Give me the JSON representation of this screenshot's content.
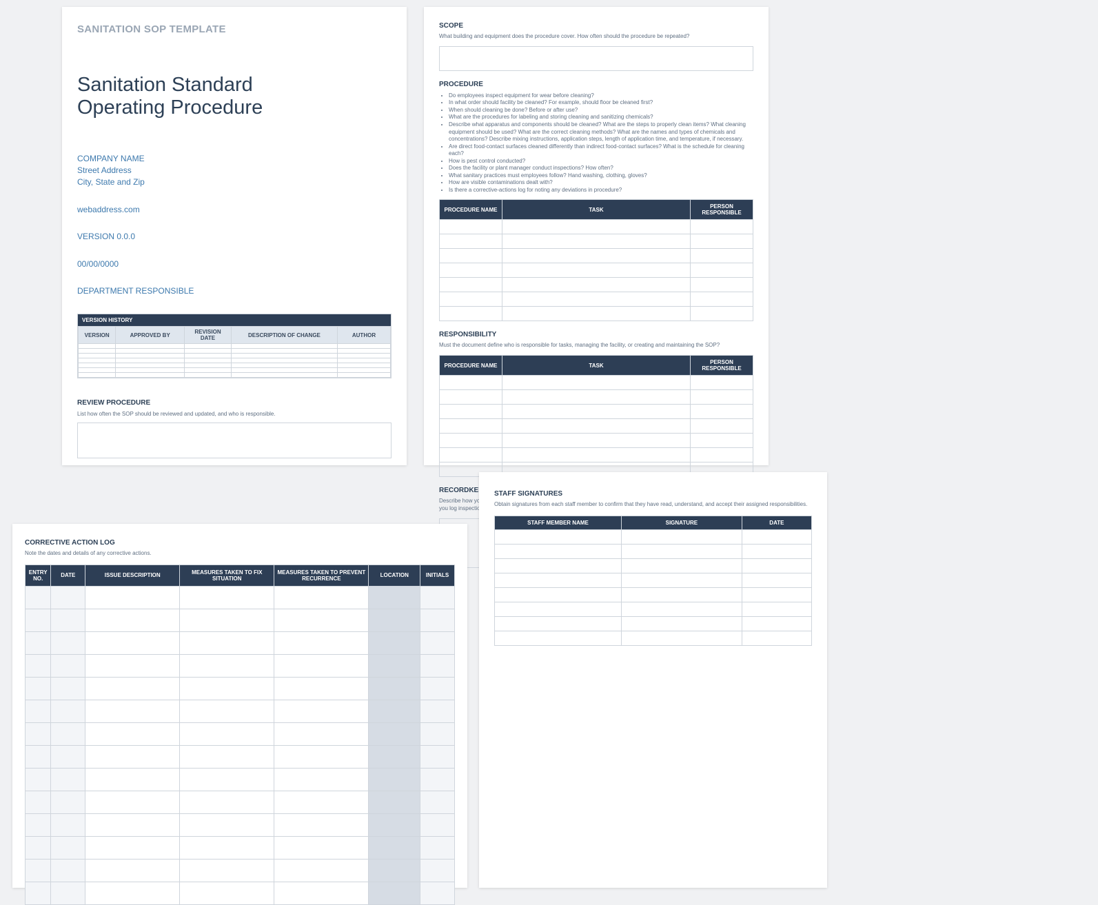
{
  "page1": {
    "template_label": "SANITATION SOP TEMPLATE",
    "title_line1": "Sanitation Standard",
    "title_line2": "Operating Procedure",
    "company": "COMPANY NAME",
    "street": "Street Address",
    "city": "City, State and Zip",
    "web": "webaddress.com",
    "version": "VERSION 0.0.0",
    "date": "00/00/0000",
    "department": "DEPARTMENT RESPONSIBLE",
    "vhist_label": "VERSION HISTORY",
    "vhist_cols": [
      "VERSION",
      "APPROVED BY",
      "REVISION DATE",
      "DESCRIPTION OF CHANGE",
      "AUTHOR"
    ],
    "review_h": "REVIEW PROCEDURE",
    "review_sub": "List how often the SOP should be reviewed and updated, and who is responsible."
  },
  "page2": {
    "scope_h": "SCOPE",
    "scope_sub": "What building and equipment does the procedure cover. How often should the procedure be repeated?",
    "proc_h": "PROCEDURE",
    "proc_items": [
      "Do employees inspect equipment for wear before cleaning?",
      "In what order should facility be cleaned? For example, should floor be cleaned first?",
      "When should cleaning be done? Before or after use?",
      "What are the procedures for labeling and storing cleaning and sanitizing chemicals?",
      "Describe what apparatus and components should be cleaned? What are the steps to properly clean items? What cleaning equipment should be used? What are the correct cleaning methods? What are the names and types of chemicals and concentrations? Describe mixing instructions, application steps, length of application time, and temperature, if necessary.",
      "Are direct food-contact surfaces cleaned differently than indirect food-contact surfaces? What is the schedule for cleaning each?",
      "How is pest control conducted?",
      "Does the facility or plant manager conduct inspections? How often?",
      "What sanitary practices must employees follow? Hand washing, clothing, gloves?",
      "How are visible contaminations dealt with?",
      "Is there a corrective-actions log for noting any deviations in procedure?"
    ],
    "proc_cols": [
      "PROCEDURE NAME",
      "TASK",
      "PERSON RESPONSIBLE"
    ],
    "resp_h": "RESPONSIBILITY",
    "resp_sub": "Must the document define who is responsible for tasks, managing the facility, or creating and maintaining the SOP?",
    "rec_h": "RECORDKEEPING AND STORAGE",
    "rec_sub": "Describe how you log when items are cleaned, types of chemicals and concentrations used, and dates of cleanings, and how you log inspections. Do you need to specify how long records are kept?"
  },
  "page3": {
    "h": "CORRECTIVE ACTION LOG",
    "sub": "Note the dates and details of any corrective actions.",
    "cols": [
      "ENTRY NO.",
      "DATE",
      "ISSUE DESCRIPTION",
      "MEASURES TAKEN TO FIX SITUATION",
      "MEASURES TAKEN TO PREVENT RECURRENCE",
      "LOCATION",
      "INITIALS"
    ]
  },
  "page4": {
    "h": "STAFF SIGNATURES",
    "sub": "Obtain signatures from each staff member to confirm that they have read, understand, and accept their assigned responsibilities.",
    "cols": [
      "STAFF MEMBER NAME",
      "SIGNATURE",
      "DATE"
    ]
  }
}
